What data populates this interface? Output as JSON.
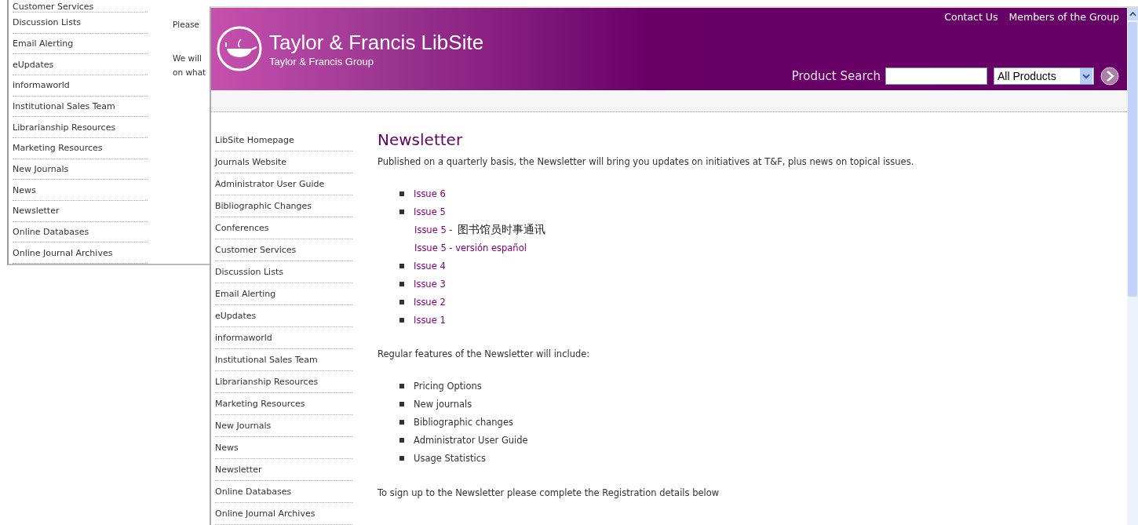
{
  "back_window": {
    "sidebar": {
      "items": [
        "Customer Services",
        "Discussion Lists",
        "Email Alerting",
        "eUpdates",
        "informaworld",
        "Institutional Sales Team",
        "Librarianship Resources",
        "Marketing Resources",
        "New Journals",
        "News",
        "Newsletter",
        "Online Databases",
        "Online Journal Archives"
      ]
    },
    "text_lines": [
      "Please",
      "We will",
      "on what"
    ]
  },
  "header": {
    "title": "Taylor & Francis LibSite",
    "subtitle": "Taylor & Francis Group",
    "links": [
      "Contact Us",
      "Members of the Group"
    ],
    "search": {
      "label": "Product Search",
      "select": "All Products"
    }
  },
  "sidebar": {
    "items": [
      "LibSite Homepage",
      "Journals Website",
      "Administrator User Guide",
      "Bibliographic Changes",
      "Conferences",
      "Customer Services",
      "Discussion Lists",
      "Email Alerting",
      "eUpdates",
      "informaworld",
      "Institutional Sales Team",
      "Librarianship Resources",
      "Marketing Resources",
      "New Journals",
      "News",
      "Newsletter",
      "Online Databases",
      "Online Journal Archives"
    ]
  },
  "content": {
    "title": "Newsletter",
    "intro": "Published on a quarterly basis, the Newsletter will bring you updates on initiatives at T&F, plus news on topical issues.",
    "issues": [
      {
        "label": "Issue 6"
      },
      {
        "label": "Issue 5",
        "extra": [
          {
            "label": "Issue 5 -",
            "note": "图书馆员时事通讯"
          },
          {
            "label": "Issue 5 - versión español"
          }
        ]
      },
      {
        "label": "Issue 4"
      },
      {
        "label": "Issue 3"
      },
      {
        "label": "Issue 2"
      },
      {
        "label": "Issue 1"
      }
    ],
    "features_intro": "Regular features of the Newsletter will include:",
    "features": [
      "Pricing Options",
      "New journals",
      "Bibliographic changes",
      "Administrator User Guide",
      "Usage Statistics"
    ],
    "signup": "To sign up to the Newsletter please complete the Registration details below"
  }
}
